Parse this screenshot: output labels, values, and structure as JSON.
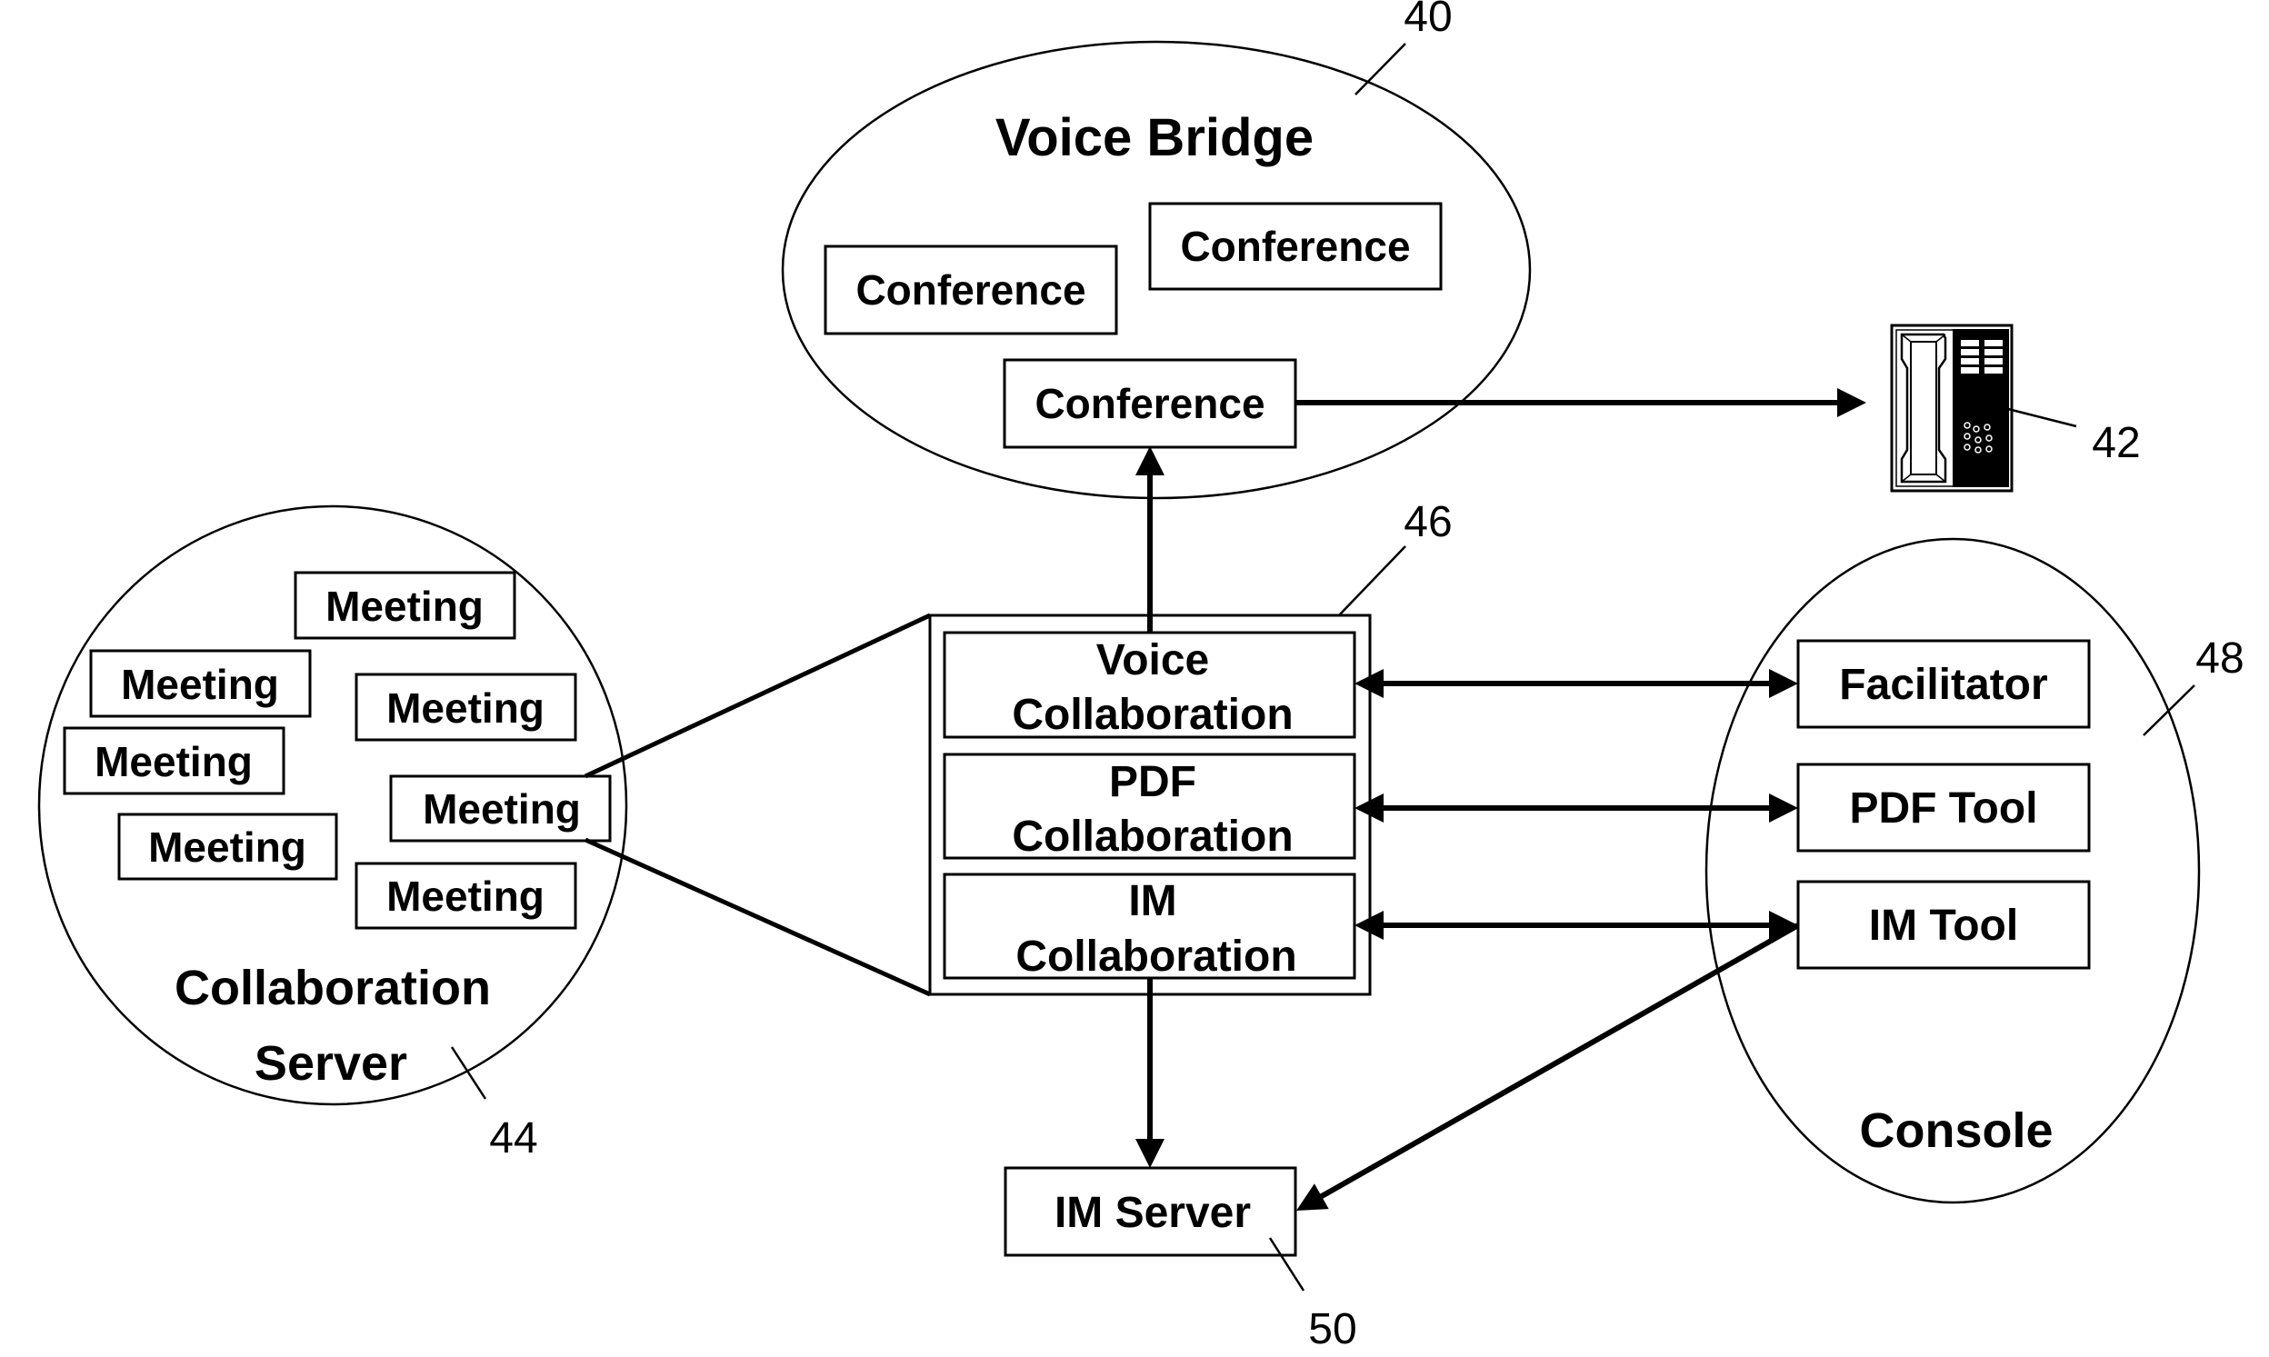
{
  "diagram": {
    "voice_bridge": {
      "title": "Voice Bridge",
      "ref": "40",
      "conferences": [
        "Conference",
        "Conference",
        "Conference"
      ]
    },
    "phone": {
      "icon": "telephone-icon",
      "ref": "42"
    },
    "collaboration_server": {
      "title_line1": "Collaboration",
      "title_line2": "Server",
      "ref": "44",
      "meetings": [
        "Meeting",
        "Meeting",
        "Meeting",
        "Meeting",
        "Meeting",
        "Meeting",
        "Meeting"
      ]
    },
    "collaboration_module": {
      "ref": "46",
      "components": [
        {
          "line1": "Voice",
          "line2": "Collaboration"
        },
        {
          "line1": "PDF",
          "line2": "Collaboration"
        },
        {
          "line1": "IM",
          "line2": "Collaboration"
        }
      ]
    },
    "console": {
      "title": "Console",
      "ref": "48",
      "tools": [
        "Facilitator",
        "PDF Tool",
        "IM Tool"
      ]
    },
    "im_server": {
      "label": "IM Server",
      "ref": "50"
    },
    "connections": [
      {
        "from": "collaboration_module.voice",
        "to": "voice_bridge.conference",
        "type": "arrow"
      },
      {
        "from": "voice_bridge.conference",
        "to": "phone",
        "type": "arrow"
      },
      {
        "from": "collaboration_module.voice",
        "to": "console.facilitator",
        "type": "double-arrow"
      },
      {
        "from": "collaboration_module.pdf",
        "to": "console.pdf_tool",
        "type": "double-arrow"
      },
      {
        "from": "collaboration_module.im",
        "to": "console.im_tool",
        "type": "double-arrow"
      },
      {
        "from": "collaboration_module.im",
        "to": "im_server",
        "type": "arrow"
      },
      {
        "from": "console.im_tool",
        "to": "im_server",
        "type": "arrow"
      },
      {
        "from": "collaboration_server.meeting",
        "to": "collaboration_module",
        "type": "expansion"
      }
    ]
  }
}
